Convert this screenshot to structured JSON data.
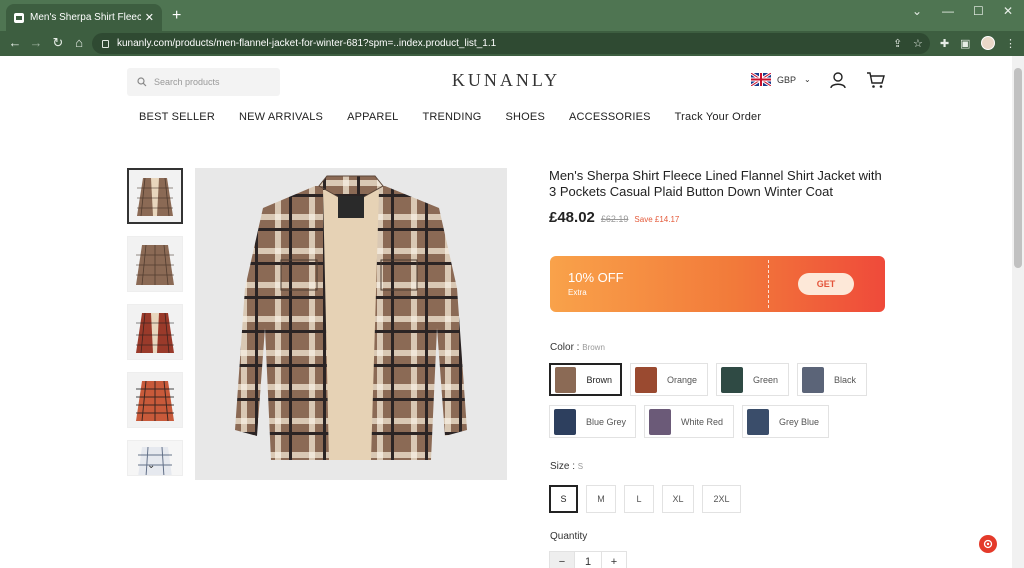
{
  "browser": {
    "tab_title": "Men's Sherpa Shirt Fleece Lined",
    "url": "kunanly.com/products/men-flannel-jacket-for-winter-681?spm=..index.product_list_1.1"
  },
  "header": {
    "search_placeholder": "Search products",
    "logo": "KUNANLY",
    "currency": "GBP"
  },
  "nav": {
    "items": [
      "BEST SELLER",
      "NEW ARRIVALS",
      "APPAREL",
      "TRENDING",
      "SHOES",
      "ACCESSORIES",
      "Track Your Order"
    ]
  },
  "product": {
    "title": "Men's Sherpa Shirt Fleece Lined Flannel Shirt Jacket with 3 Pockets Casual Plaid Button Down Winter Coat",
    "price": "£48.02",
    "old_price": "£62.19",
    "save": "Save £14.17",
    "coupon": {
      "percent": "10% OFF",
      "extra": "Extra",
      "button": "GET"
    },
    "color_label": "Color :",
    "color_value": "Brown",
    "colors": [
      {
        "name": "Brown",
        "hex": "#8b6a55"
      },
      {
        "name": "Orange",
        "hex": "#9a4a30"
      },
      {
        "name": "Green",
        "hex": "#2f4a44"
      },
      {
        "name": "Black",
        "hex": "#5b6478"
      },
      {
        "name": "Blue Grey",
        "hex": "#2d3f5e"
      },
      {
        "name": "White Red",
        "hex": "#6b5a78"
      },
      {
        "name": "Grey Blue",
        "hex": "#3a4d6a"
      }
    ],
    "size_label": "Size :",
    "size_value": "S",
    "sizes": [
      "S",
      "M",
      "L",
      "XL",
      "2XL"
    ],
    "quantity_label": "Quantity",
    "quantity": "1",
    "minus": "−",
    "plus": "+"
  },
  "colors": {
    "chrome": "#4f7552",
    "accent": "#e4543a"
  }
}
